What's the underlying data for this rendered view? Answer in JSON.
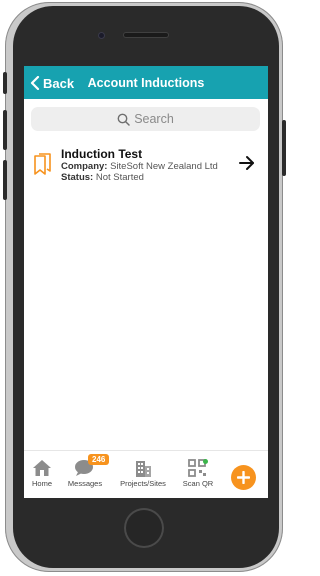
{
  "header": {
    "back_label": "Back",
    "title": "Account Inductions"
  },
  "search": {
    "placeholder": "Search"
  },
  "inductions": [
    {
      "title": "Induction Test",
      "company_label": "Company:",
      "company_value": "SiteSoft New Zealand Ltd",
      "status_label": "Status:",
      "status_value": "Not Started",
      "icon": "bookmark-icon",
      "action_icon": "arrow-right-icon"
    }
  ],
  "tabbar": {
    "tabs": [
      {
        "label": "Home",
        "icon": "home-icon"
      },
      {
        "label": "Messages",
        "icon": "chat-icon",
        "badge": "246"
      },
      {
        "label": "Projects/Sites",
        "icon": "building-icon"
      },
      {
        "label": "Scan QR",
        "icon": "qr-icon"
      }
    ],
    "fab_icon": "plus-icon"
  },
  "colors": {
    "header": "#17a2b0",
    "accent": "#f7931e",
    "search_bg": "#eeeeee"
  }
}
